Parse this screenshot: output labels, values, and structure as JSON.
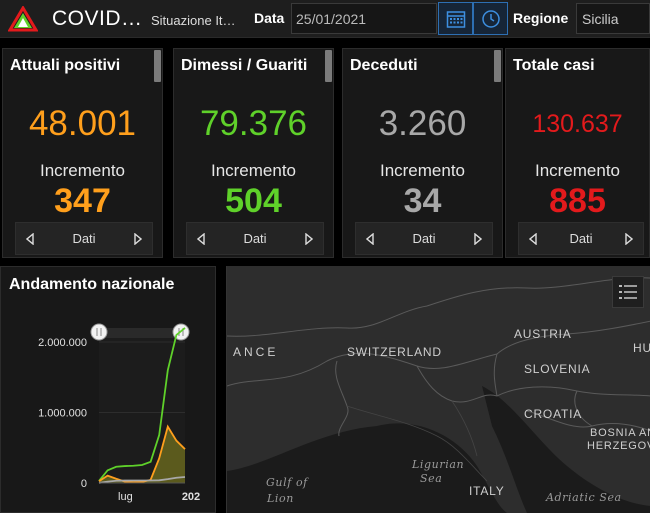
{
  "header": {
    "title": "COVID…",
    "subtitle": "Situazione It…",
    "date_label": "Data",
    "date_value": "25/01/2021",
    "region_label": "Regione",
    "region_value": "Sicilia",
    "calendar_icon": "calendar-icon",
    "clock_icon": "clock-icon",
    "logo_icon": "alert-triangle-logo"
  },
  "cards": [
    {
      "title": "Attuali positivi",
      "value": "48.001",
      "increment_label": "Incremento",
      "increment": "347",
      "nav_label": "Dati",
      "color": "#ff9f1c"
    },
    {
      "title": "Dimessi / Guariti",
      "value": "79.376",
      "increment_label": "Incremento",
      "increment": "504",
      "nav_label": "Dati",
      "color": "#5fd12a"
    },
    {
      "title": "Deceduti",
      "value": "3.260",
      "increment_label": "Incremento",
      "increment": "34",
      "nav_label": "Dati",
      "color": "#a8a8a8"
    },
    {
      "title": "Totale casi",
      "value": "130.637",
      "increment_label": "Incremento",
      "increment": "885",
      "nav_label": "Dati",
      "color": "#e31a1c"
    }
  ],
  "chart": {
    "title": "Andamento nazionale"
  },
  "chart_data": {
    "type": "line",
    "x": [
      "2020-03",
      "2020-04",
      "2020-05",
      "2020-06",
      "2020-07",
      "2020-08",
      "2020-09",
      "2020-10",
      "2020-11",
      "2020-12",
      "2021-01"
    ],
    "x_tick_labels": [
      "lug",
      "202"
    ],
    "y_tick_labels": [
      "2.000.000",
      "1.000.000",
      "0"
    ],
    "ylim": [
      0,
      2000000
    ],
    "series": [
      {
        "values": [
          30000,
          180000,
          230000,
          240000,
          245000,
          255000,
          300000,
          680000,
          1600000,
          2100000,
          2450000
        ],
        "color": "#5fd12a"
      },
      {
        "values": [
          25000,
          105000,
          60000,
          20000,
          12000,
          15000,
          45000,
          350000,
          800000,
          600000,
          480000
        ],
        "color": "#ff9f1c"
      },
      {
        "values": [
          1000,
          20000,
          32000,
          34500,
          35000,
          35400,
          35900,
          38000,
          55000,
          75000,
          85000
        ],
        "color": "#a8a8a8"
      }
    ]
  },
  "map": {
    "labels": [
      "ANCE",
      "SWITZERLAND",
      "AUSTRIA",
      "SLOVENIA",
      "CROATIA",
      "BOSNIA AND",
      "HERZEGOV",
      "ITALY",
      "HU"
    ],
    "seas": [
      "Ligurian",
      "Sea",
      "Gulf of",
      "Lion",
      "Adriatic Sea"
    ],
    "legend_icon": "legend-list-icon"
  }
}
